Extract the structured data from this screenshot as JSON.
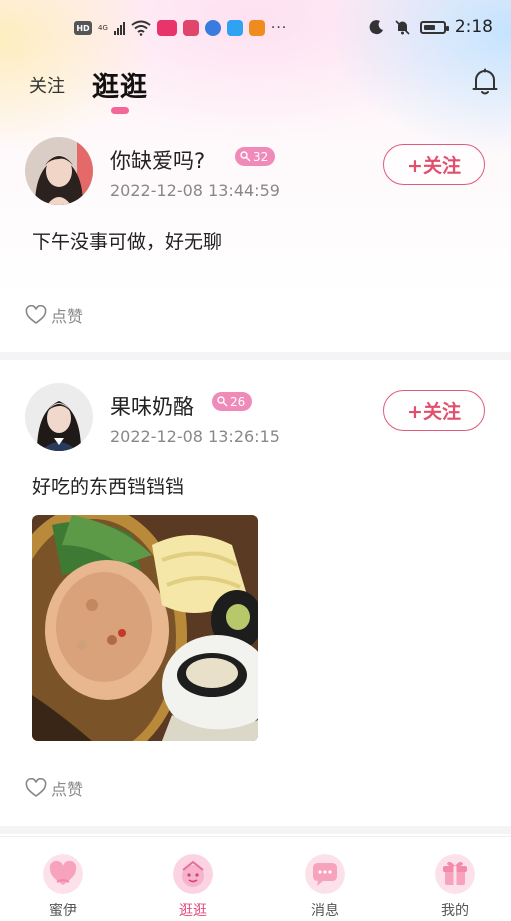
{
  "status_bar": {
    "hd": "HD",
    "network": "4G",
    "time": "2:18",
    "battery_level": 0.6,
    "app_icon_colors": [
      "#e8336b",
      "#e0456b",
      "#3a7be0",
      "#2ea3f2",
      "#f08c1e"
    ]
  },
  "header": {
    "tabs": [
      {
        "label": "关注",
        "active": false
      },
      {
        "label": "逛逛",
        "active": true
      }
    ],
    "accent_color": "#f2669a"
  },
  "posts": [
    {
      "user_name": "你缺爱吗?",
      "level": "32",
      "time": "2022-12-08 13:44:59",
      "follow_label": "+关注",
      "text": "下午没事可做，好无聊",
      "like_label": "点赞"
    },
    {
      "user_name": "果味奶酪",
      "level": "26",
      "time": "2022-12-08 13:26:15",
      "follow_label": "+关注",
      "text": "好吃的东西铛铛铛",
      "like_label": "点赞"
    }
  ],
  "bottom_nav": [
    {
      "label": "蜜伊",
      "icon": "heart-icon",
      "active": false
    },
    {
      "label": "逛逛",
      "icon": "face-icon",
      "active": true
    },
    {
      "label": "消息",
      "icon": "chat-icon",
      "active": false
    },
    {
      "label": "我的",
      "icon": "gift-icon",
      "active": false
    }
  ]
}
